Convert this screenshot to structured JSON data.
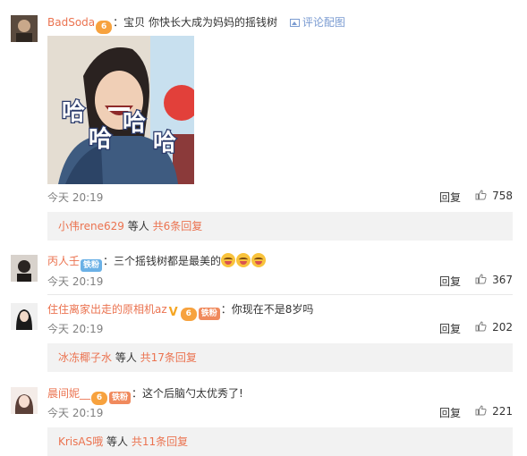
{
  "comments": [
    {
      "username": "BadSoda",
      "colon": "：",
      "text": "宝贝 你快长大成为妈妈的摇钱树",
      "pic_link": "评论配图",
      "time": "今天 20:19",
      "reply": "回复",
      "likes": "758",
      "sub_reply": {
        "name": "小伟rene629",
        "mid": " 等人 ",
        "link": "共6条回复"
      },
      "image_text": [
        "哈",
        "哈",
        "哈",
        "哈"
      ]
    },
    {
      "username": "丙人壬",
      "badge": "铁粉",
      "colon": "：",
      "text": "三个摇钱树都是最美的",
      "time": "今天 20:19",
      "reply": "回复",
      "likes": "367"
    },
    {
      "username": "住住离家出走的原相机az",
      "badge": "铁粉",
      "colon": "：",
      "text": "你现在不是8岁吗",
      "time": "今天 20:19",
      "reply": "回复",
      "likes": "202",
      "sub_reply": {
        "name": "冰冻椰子水",
        "mid": " 等人 ",
        "link": "共17条回复"
      }
    },
    {
      "username": "晨间妮__",
      "badge": "铁粉",
      "colon": "：",
      "text": "这个后脑勺太优秀了!",
      "time": "今天 20:19",
      "reply": "回复",
      "likes": "221",
      "sub_reply": {
        "name": "KrisAS哦",
        "mid": " 等人 ",
        "link": "共11条回复"
      }
    }
  ],
  "icons": {
    "vip": "vip-badge-icon",
    "pic": "image-icon",
    "like": "thumbs-up-icon",
    "verified": "verified-v-icon"
  },
  "colors": {
    "username": "#eb7350",
    "meta": "#808080",
    "subbox_bg": "#f2f2f2"
  }
}
